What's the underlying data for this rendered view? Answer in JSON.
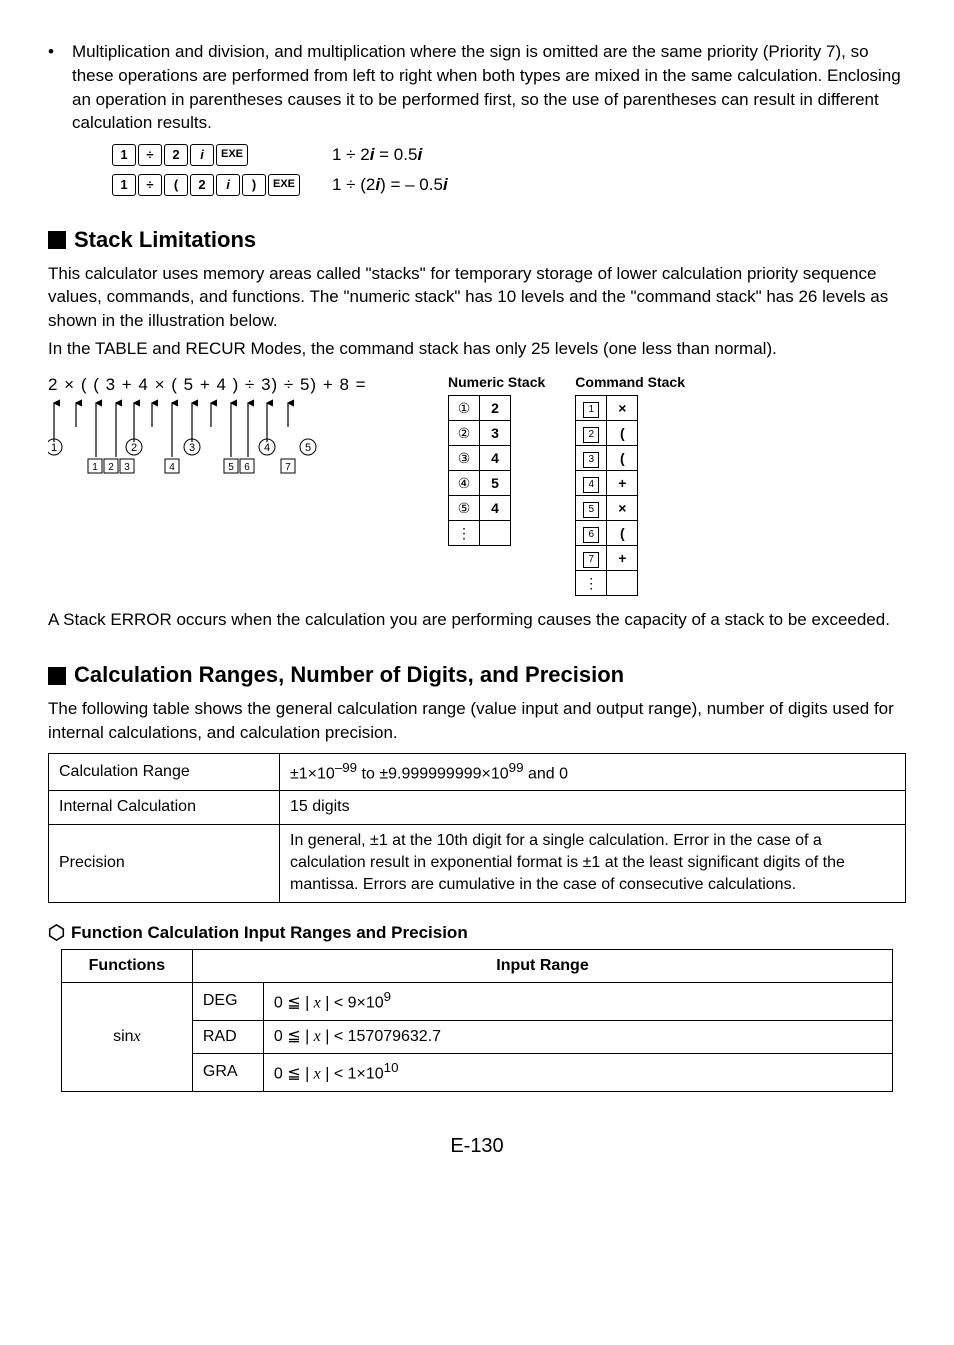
{
  "intro": {
    "bullet_text": "Multiplication and division, and multiplication where the sign is omitted are the same priority (Priority 7), so these operations are performed from left to right when both types are mixed in the same calculation. Enclosing an operation in parentheses causes it to be performed first, so the use of parentheses can result in different calculation results."
  },
  "key_examples": [
    {
      "keys": [
        "1",
        "÷",
        "2",
        "i",
        "EXE"
      ],
      "result_prefix": "1 ÷ 2",
      "result_i1": "i",
      "result_mid": " = 0.5",
      "result_i2": "i"
    },
    {
      "keys": [
        "1",
        "÷",
        "(",
        "2",
        "i",
        ")",
        "EXE"
      ],
      "result_prefix": "1 ÷ (2",
      "result_i1": "i",
      "result_mid": ") = – 0.5",
      "result_i2": "i"
    }
  ],
  "stack": {
    "heading": "Stack Limitations",
    "para1": "This calculator uses memory areas called \"stacks\" for temporary storage of lower calculation priority sequence values, commands, and functions. The \"numeric stack\" has 10 levels and the \"command stack\" has 26 levels as shown in the illustration below.",
    "para2": "In the TABLE and RECUR Modes, the command stack has only 25 levels (one less than normal).",
    "expression": "2 × ( ( 3 + 4 × ( 5 + 4 ) ÷ 3) ÷ 5) + 8 =",
    "numeric_title": "Numeric Stack",
    "command_title": "Command Stack",
    "numeric_rows": [
      {
        "idx": "①",
        "val": "2"
      },
      {
        "idx": "②",
        "val": "3"
      },
      {
        "idx": "③",
        "val": "4"
      },
      {
        "idx": "④",
        "val": "5"
      },
      {
        "idx": "⑤",
        "val": "4"
      }
    ],
    "command_rows": [
      {
        "idx": "1",
        "val": "×"
      },
      {
        "idx": "2",
        "val": "("
      },
      {
        "idx": "3",
        "val": "("
      },
      {
        "idx": "4",
        "val": "+"
      },
      {
        "idx": "5",
        "val": "×"
      },
      {
        "idx": "6",
        "val": "("
      },
      {
        "idx": "7",
        "val": "+"
      }
    ],
    "error_text": "A Stack ERROR occurs when the calculation you are performing causes the capacity of a stack to be exceeded."
  },
  "ranges": {
    "heading": "Calculation Ranges, Number of Digits, and Precision",
    "intro": "The following table shows the general calculation range (value input and output range), number of digits used for internal calculations, and calculation precision.",
    "rows": [
      {
        "label": "Calculation Range",
        "value_html": "±1×10<sup>–99</sup> to ±9.999999999×10<sup>99</sup> and 0"
      },
      {
        "label": "Internal Calculation",
        "value_html": "15 digits"
      },
      {
        "label": "Precision",
        "value_html": "In general, ±1 at the 10th digit for a single calculation. Error in the case of a calculation result in exponential format is ±1 at the least significant digits of the mantissa. Errors are cumulative in the case of consecutive calculations."
      }
    ]
  },
  "func_ranges": {
    "heading": "Function Calculation Input Ranges and Precision",
    "th_functions": "Functions",
    "th_range": "Input Range",
    "fn": "sin",
    "fn_var": "x",
    "rows": [
      {
        "unit": "DEG",
        "range_html": "0 ≦ | <span class='mathit'>x</span> | < 9×10<sup>9</sup>"
      },
      {
        "unit": "RAD",
        "range_html": "0 ≦ | <span class='mathit'>x</span> | < 157079632.7"
      },
      {
        "unit": "GRA",
        "range_html": "0 ≦ | <span class='mathit'>x</span> | < 1×10<sup>10</sup>"
      }
    ]
  },
  "page_number": "E-130"
}
